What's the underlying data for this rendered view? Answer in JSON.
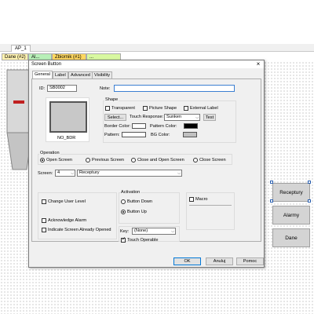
{
  "editor": {
    "doc_tab": "AP_1",
    "screen_tabs": [
      "Dane (#2)",
      "Al...",
      "Zbiornik (#1)",
      "..."
    ],
    "side_buttons": [
      "Receptury",
      "Alarmy",
      "Dane"
    ]
  },
  "dialog": {
    "title": "Screen Button",
    "close_glyph": "×",
    "tabs": [
      "General",
      "Label",
      "Advanced",
      "Visibility"
    ],
    "active_tab": "General",
    "id_label": "ID:",
    "id_value": "SB0002",
    "note_label": "Note:",
    "note_value": "",
    "preview_caption": "NO_BDR",
    "shape": {
      "group_label": "Shape",
      "transparent": "Transparent",
      "picture_shape": "Picture Shape",
      "external_label": "External Label",
      "select_button": "Select...",
      "touch_response_label": "Touch Response:",
      "touch_response_value": "Sunken",
      "test_button": "Test",
      "border_color_label": "Border Color:",
      "pattern_color_label": "Pattern Color:",
      "pattern_label": "Pattern:",
      "bg_color_label": "BG Color:"
    },
    "operation": {
      "group_label": "Operation",
      "options": [
        "Open Screen",
        "Previous Screen",
        "Close and Open Screen",
        "Close Screen"
      ],
      "selected": "Open Screen"
    },
    "screen": {
      "label": "Screen:",
      "number": "4",
      "name": "Receptury"
    },
    "options_left": {
      "change_user_level": "Change User Level",
      "acknowledge_alarm": "Acknowledge Alarm",
      "indicate_screen_open": "Indicate Screen Already Opened"
    },
    "activation": {
      "group_label": "Activation",
      "options": [
        "Button Down",
        "Button Up"
      ],
      "selected": "Button Up"
    },
    "macro_label": "Macro",
    "key": {
      "label": "Key:",
      "value": "(None)"
    },
    "touch_operable": "Touch Operable",
    "buttons": {
      "ok": "OK",
      "cancel": "Anuluj",
      "help": "Pomoc"
    }
  }
}
